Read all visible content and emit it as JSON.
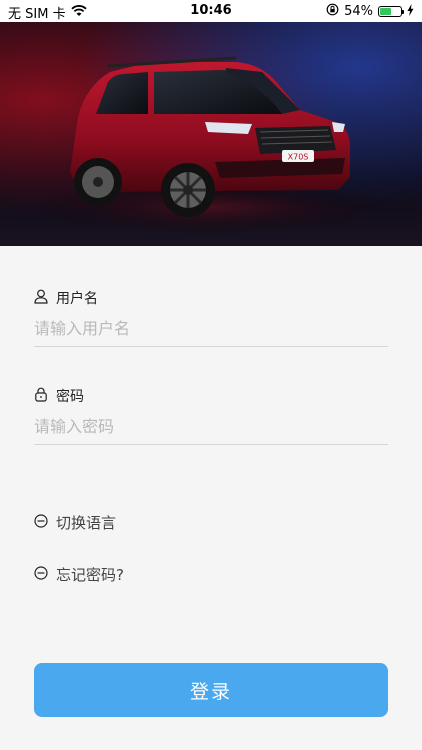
{
  "status_bar": {
    "carrier": "无 SIM 卡",
    "time": "10:46",
    "battery_percent": "54%",
    "battery_level": 0.54,
    "icons": [
      "wifi-icon",
      "orientation-lock-icon",
      "battery-icon",
      "charging-icon"
    ]
  },
  "hero": {
    "badge_text": "X70S"
  },
  "form": {
    "username": {
      "label": "用户名",
      "placeholder": "请输入用户名",
      "value": "",
      "icon": "user-icon"
    },
    "password": {
      "label": "密码",
      "placeholder": "请输入密码",
      "value": "",
      "icon": "lock-icon"
    }
  },
  "links": {
    "switch_language": {
      "label": "切换语言",
      "icon": "circle-minus-icon"
    },
    "forgot_password": {
      "label": "忘记密码?",
      "icon": "circle-minus-icon"
    }
  },
  "login_button": {
    "label": "登录"
  },
  "colors": {
    "accent": "#4aa8ee",
    "background": "#f5f5f5",
    "battery": "#34c759"
  }
}
